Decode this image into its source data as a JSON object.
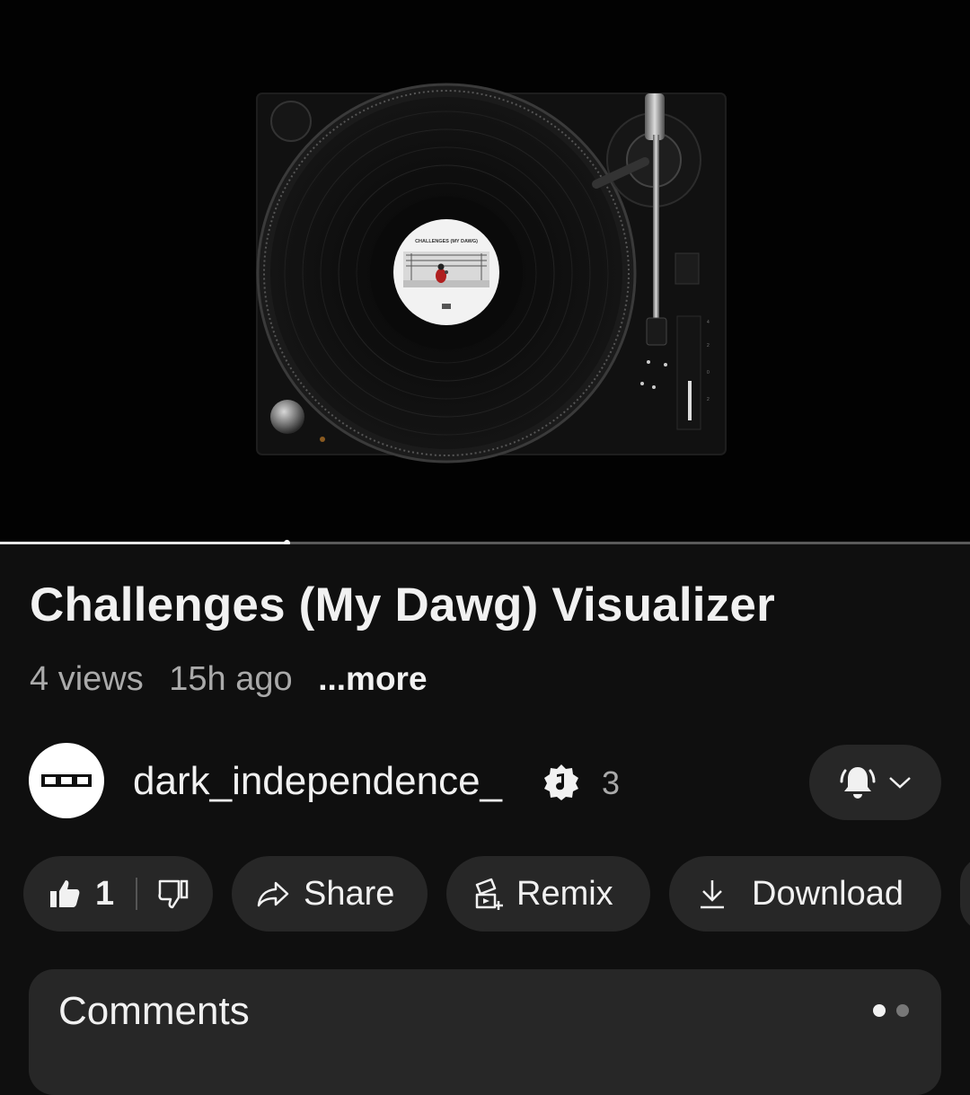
{
  "player": {
    "label_text": "CHALLENGES (MY DAWG)",
    "progress_fraction": 0.295
  },
  "video": {
    "title": "Challenges (My Dawg) Visualizer",
    "views": "4 views",
    "age": "15h ago",
    "more_label": "...more"
  },
  "channel": {
    "name": "dark_independence_",
    "subscribers": "3",
    "badge_icon": "music-note-badge-icon",
    "bell_icon": "bell-ringing-icon"
  },
  "actions": {
    "likes": "1",
    "share_label": "Share",
    "remix_label": "Remix",
    "download_label": "Download"
  },
  "comments": {
    "title": "Comments",
    "page_count": 2,
    "active_page": 0
  },
  "colors": {
    "background": "#0f0f0f",
    "chip": "#272727",
    "muted_text": "#aaaaaa"
  }
}
